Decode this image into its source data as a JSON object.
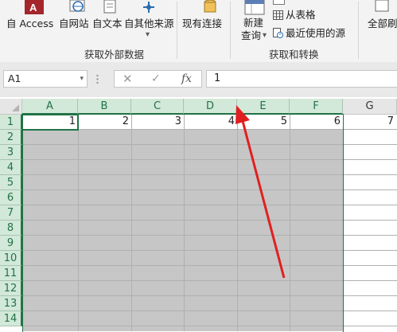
{
  "ribbon": {
    "get_external": {
      "label": "获取外部数据",
      "buttons": [
        {
          "label": "自 Access",
          "icon": "access-icon"
        },
        {
          "label": "自网站",
          "icon": "web-globe-icon"
        },
        {
          "label": "自文本",
          "icon": "text-file-icon"
        },
        {
          "label": "自其他来源",
          "icon": "other-sources-icon",
          "dropdown": "▾"
        }
      ],
      "existing_connections": "现有连接"
    },
    "get_transform": {
      "label": "获取和转换",
      "new_query": "新建",
      "new_query_line2": "查询",
      "new_query_arrow": "▾",
      "from_table": "从表格",
      "recent_sources": "最近使用的源"
    },
    "refresh_all": "全部刷"
  },
  "formula_bar": {
    "name_box": "A1",
    "name_box_arrow": "▾",
    "cancel": "✕",
    "enter": "✓",
    "fx": "fx",
    "value": "1"
  },
  "sheet": {
    "columns": [
      "A",
      "B",
      "C",
      "D",
      "E",
      "F",
      "G"
    ],
    "rows": [
      "1",
      "2",
      "3",
      "4",
      "5",
      "6",
      "7",
      "8",
      "9",
      "10",
      "11",
      "12",
      "13",
      "14"
    ],
    "row1_values": [
      "1",
      "2",
      "3",
      "4",
      "5",
      "6",
      "7"
    ],
    "selection": "A1:F14",
    "colors": {
      "accent": "#217346",
      "selection": "#c6c6c6",
      "header_selected": "#d2e8d8",
      "arrow": "#e02020"
    }
  }
}
